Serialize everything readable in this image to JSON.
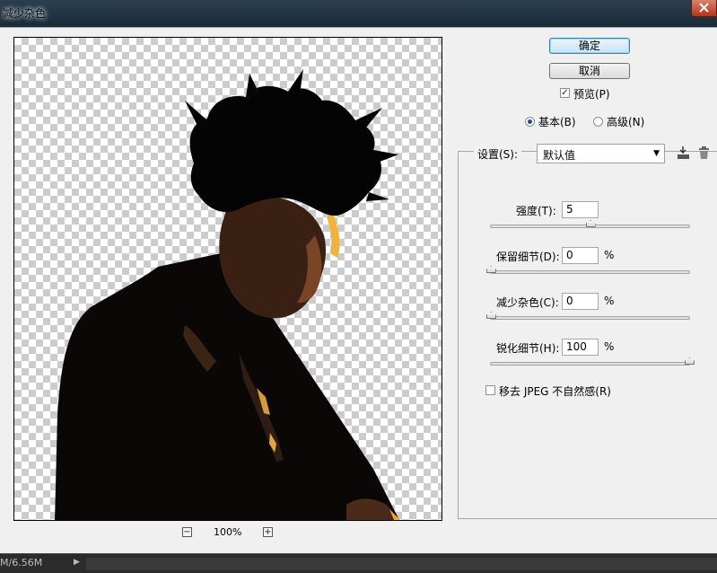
{
  "window": {
    "title": "减少杂色"
  },
  "preview": {
    "zoom": "100%",
    "zoom_out_symbol": "−",
    "zoom_in_symbol": "+"
  },
  "buttons": {
    "ok": "确定",
    "cancel": "取消"
  },
  "preview_toggle": {
    "label": "预览(P)",
    "checked": true
  },
  "mode": {
    "basic": {
      "label": "基本(B)",
      "selected": true
    },
    "advanced": {
      "label": "高级(N)",
      "selected": false
    }
  },
  "settings": {
    "label": "设置(S):",
    "value": "默认值",
    "icons": [
      "save-preset-icon",
      "trash-icon"
    ]
  },
  "params": {
    "strength": {
      "label": "强度(T):",
      "value": "5",
      "unit": "",
      "slider_fraction": 0.5
    },
    "preserve_details": {
      "label": "保留细节(D):",
      "value": "0",
      "unit": "%",
      "slider_fraction": 0.0
    },
    "reduce_color_noise": {
      "label": "减少杂色(C):",
      "value": "0",
      "unit": "%",
      "slider_fraction": 0.0
    },
    "sharpen_details": {
      "label": "锐化细节(H):",
      "value": "100",
      "unit": "%",
      "slider_fraction": 1.0
    }
  },
  "jpeg_artifact": {
    "label": "移去 JPEG 不自然感(R)",
    "checked": false
  },
  "statusbar": {
    "text": "M/6.56M"
  }
}
